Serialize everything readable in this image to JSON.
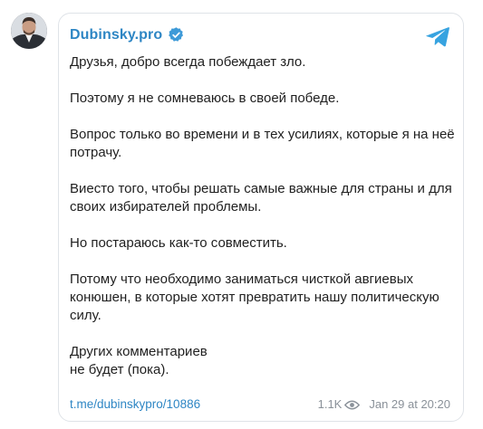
{
  "channel": {
    "name": "Dubinsky.pro"
  },
  "message": {
    "paragraphs": [
      "Друзья, добро всегда побеждает зло.",
      "Поэтому я не сомневаюсь в своей победе.",
      "Вопрос только во времени и в тех усилиях, которые я на неё потрачу.",
      "Виесто того, чтобы решать самые важные для страны и для своих избирателей проблемы.",
      "Но постараюсь как-то совместить.",
      "Потому что необходимо заниматься чисткой авгиевых конюшен, в которые хотят превратить нашу политическую силу.",
      "Других комментариев\nне будет (пока)."
    ]
  },
  "footer": {
    "link": "t.me/dubinskypro/10886",
    "views": "1.1K",
    "date": "Jan 29 at 20:20"
  },
  "icons": {
    "verified": "verified-badge-icon",
    "telegram": "telegram-logo-icon",
    "views": "eye-icon"
  },
  "colors": {
    "accent": "#2e86c4",
    "text": "#1f1f1f",
    "muted": "#8a9199",
    "border": "#dfe3e8"
  }
}
